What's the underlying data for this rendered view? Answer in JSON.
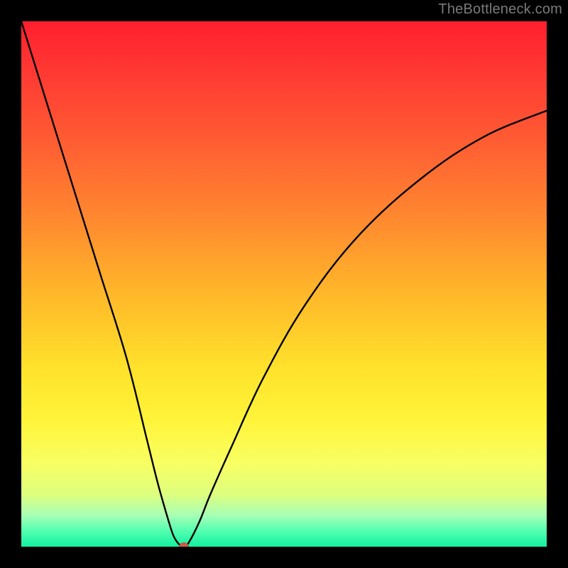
{
  "attribution": "TheBottleneck.com",
  "chart_data": {
    "type": "line",
    "title": "",
    "xlabel": "",
    "ylabel": "",
    "xlim": [
      0,
      100
    ],
    "ylim": [
      0,
      100
    ],
    "grid": false,
    "legend": false,
    "series": [
      {
        "name": "curve",
        "x": [
          0,
          5,
          10,
          15,
          20,
          24,
          26,
          28,
          29,
          30,
          31,
          32,
          34,
          36,
          40,
          46,
          54,
          64,
          76,
          88,
          100
        ],
        "y": [
          100,
          84,
          68,
          52,
          36,
          20,
          12,
          5,
          2,
          0.5,
          0,
          1,
          5,
          10,
          19,
          32,
          46,
          59,
          70,
          78,
          83
        ]
      }
    ],
    "marker": {
      "x": 31,
      "y": 0
    },
    "background_gradient": {
      "top_color": "#ff1f2e",
      "bottom_color": "#12f0a0"
    }
  }
}
